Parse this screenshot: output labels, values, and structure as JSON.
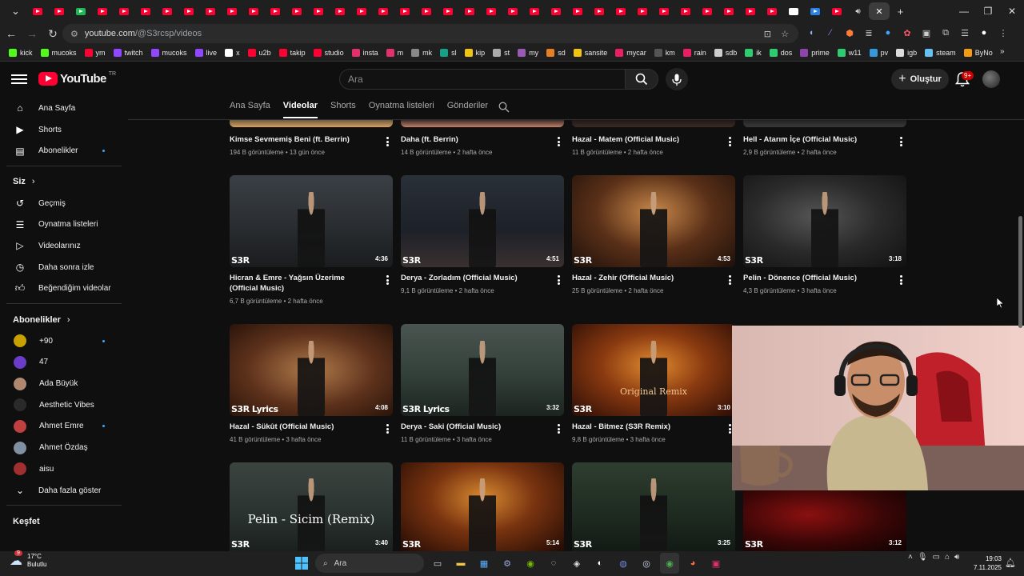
{
  "browser": {
    "url_host": "youtube.com",
    "url_path": "/@S3rcsp/videos",
    "bookmarks": [
      {
        "label": "kick",
        "color": "#53fc18"
      },
      {
        "label": "mucoks",
        "color": "#53fc18"
      },
      {
        "label": "ym",
        "color": "#ff0033"
      },
      {
        "label": "twitch",
        "color": "#9146ff"
      },
      {
        "label": "mucoks",
        "color": "#9146ff"
      },
      {
        "label": "live",
        "color": "#9146ff"
      },
      {
        "label": "x",
        "color": "#ffffff"
      },
      {
        "label": "u2b",
        "color": "#ff0033"
      },
      {
        "label": "takip",
        "color": "#ff0033"
      },
      {
        "label": "studio",
        "color": "#ff0033"
      },
      {
        "label": "insta",
        "color": "#e1306c"
      },
      {
        "label": "m",
        "color": "#e1306c"
      },
      {
        "label": "mk",
        "color": "#888888"
      },
      {
        "label": "sl",
        "color": "#16a085"
      },
      {
        "label": "kip",
        "color": "#f1c40f"
      },
      {
        "label": "st",
        "color": "#aaaaaa"
      },
      {
        "label": "my",
        "color": "#9b59b6"
      },
      {
        "label": "sd",
        "color": "#e67e22"
      },
      {
        "label": "sansite",
        "color": "#f1c40f"
      },
      {
        "label": "mycar",
        "color": "#e91e63"
      },
      {
        "label": "km",
        "color": "#555555"
      },
      {
        "label": "rain",
        "color": "#e91e63"
      },
      {
        "label": "sdb",
        "color": "#cccccc"
      },
      {
        "label": "ik",
        "color": "#2ecc71"
      },
      {
        "label": "dos",
        "color": "#2ecc71"
      },
      {
        "label": "prime",
        "color": "#8e44ad"
      },
      {
        "label": "w11",
        "color": "#2ecc71"
      },
      {
        "label": "pv",
        "color": "#3498db"
      },
      {
        "label": "igb",
        "color": "#dddddd"
      },
      {
        "label": "steam",
        "color": "#66c0f4"
      },
      {
        "label": "ByNo",
        "color": "#f39c12"
      }
    ]
  },
  "header": {
    "logo_text": "YouTube",
    "logo_region": "TR",
    "search_placeholder": "Ara",
    "create_label": "Oluştur",
    "notifications_badge": "9+"
  },
  "sidebar": {
    "main": [
      {
        "label": "Ana Sayfa",
        "icon": "home-icon",
        "dot": false
      },
      {
        "label": "Shorts",
        "icon": "shorts-icon",
        "dot": false
      },
      {
        "label": "Abonelikler",
        "icon": "subscriptions-icon",
        "dot": true
      }
    ],
    "you_heading": "Siz",
    "you": [
      {
        "label": "Geçmiş",
        "icon": "history-icon"
      },
      {
        "label": "Oynatma listeleri",
        "icon": "playlists-icon"
      },
      {
        "label": "Videolarınız",
        "icon": "your-videos-icon"
      },
      {
        "label": "Daha sonra izle",
        "icon": "watch-later-icon"
      },
      {
        "label": "Beğendiğim videolar",
        "icon": "liked-icon"
      }
    ],
    "subs_heading": "Abonelikler",
    "subs": [
      {
        "label": "+90",
        "dot": true,
        "color": "#c8a000"
      },
      {
        "label": "47",
        "dot": false,
        "color": "#6a3cc8"
      },
      {
        "label": "Ada Büyük",
        "dot": false,
        "color": "#b08870"
      },
      {
        "label": "Aesthetic Vibes",
        "dot": false,
        "color": "#2a2a2a"
      },
      {
        "label": "Ahmet Emre",
        "dot": true,
        "color": "#c04040"
      },
      {
        "label": "Ahmet Özdaş",
        "dot": false,
        "color": "#8090a0"
      },
      {
        "label": "aisu",
        "dot": false,
        "color": "#a03030"
      }
    ],
    "show_more": "Daha fazla göster",
    "explore_heading": "Keşfet"
  },
  "channel_tabs": [
    "Ana Sayfa",
    "Videolar",
    "Shorts",
    "Oynatma listeleri",
    "Gönderiler"
  ],
  "channel_tab_active": 1,
  "videos_row0": [
    {
      "title": "Kimse Sevmemiş Beni (ft. Berrin)",
      "meta": "194 B görüntüleme • 13 gün önce"
    },
    {
      "title": "Daha (ft. Berrin)",
      "meta": "14 B görüntüleme • 2 hafta önce"
    },
    {
      "title": "Hazal - Matem (Official Music)",
      "meta": "11 B görüntüleme • 2 hafta önce"
    },
    {
      "title": "Hell - Atarım İçe (Official Music)",
      "meta": "2,9 B görüntüleme • 2 hafta önce"
    }
  ],
  "videos": [
    {
      "title": "Hicran & Emre - Yağsın Üzerime (Official Music)",
      "meta": "6,7 B görüntüleme • 2 hafta önce",
      "duration": "4:36",
      "wm": "S3R",
      "bg": "linear-gradient(180deg,#3a3f45 0%,#2b2f33 50%,#1a1c1e 100%)"
    },
    {
      "title": "Derya - Zorladım (Official Music)",
      "meta": "9,1 B görüntüleme • 2 hafta önce",
      "duration": "4:51",
      "wm": "S3R",
      "bg": "linear-gradient(180deg,#2a3038 0%,#1d2128 60%,#3a3030 100%)"
    },
    {
      "title": "Hazal - Zehir (Official Music)",
      "meta": "25 B görüntüleme • 2 hafta önce",
      "duration": "4:53",
      "wm": "S3R",
      "bg": "radial-gradient(ellipse at 50% 40%,#c8884a 0%,#5a3018 50%,#1e100a 100%)"
    },
    {
      "title": "Pelin - Dönence (Official Music)",
      "meta": "4,3 B görüntüleme • 3 hafta önce",
      "duration": "3:18",
      "wm": "S3R",
      "bg": "radial-gradient(ellipse at 45% 45%,#555 0%,#2a2a2a 50%,#111 100%)"
    },
    {
      "title": "Hazal - Sükût (Official Music)",
      "meta": "41 B görüntüleme • 3 hafta önce",
      "duration": "4:08",
      "wm": "S3R Lyrics",
      "bg": "radial-gradient(ellipse at 50% 50%,#b07a4a 0%,#5e321c 55%,#2a140a 100%)"
    },
    {
      "title": "Derya - Saki (Official Music)",
      "meta": "11 B görüntüleme • 3 hafta önce",
      "duration": "3:32",
      "wm": "S3R Lyrics",
      "bg": "linear-gradient(180deg,#4a5450 0%,#33403a 55%,#1c2420 100%)"
    },
    {
      "title": "Hazal - Bitmez (S3R Remix)",
      "meta": "9,8 B görüntüleme • 3 hafta önce",
      "duration": "3:10",
      "wm": "S3R",
      "overlay": "Original Remix",
      "bg": "radial-gradient(ellipse at 50% 45%,#e08a30 0%,#8a3a10 45%,#2a0c06 100%)"
    },
    {
      "title": "",
      "meta": "",
      "duration": "",
      "wm": "",
      "bg": "none"
    },
    {
      "title": "",
      "meta": "",
      "duration": "3:40",
      "wm": "S3R",
      "overlay": "Pelin - Sicim (Remix)",
      "bg": "linear-gradient(180deg,#3c4440 0%,#2a3230 60%,#1a201e 100%)"
    },
    {
      "title": "",
      "meta": "",
      "duration": "5:14",
      "wm": "S3R",
      "bg": "radial-gradient(ellipse at 50% 40%,#d88a30 0%,#7a3410 45%,#220a04 100%)"
    },
    {
      "title": "",
      "meta": "",
      "duration": "3:25",
      "wm": "S3R",
      "bg": "linear-gradient(180deg,#2e3e30 0%,#1e2a20 60%,#121a14 100%)"
    },
    {
      "title": "",
      "meta": "",
      "duration": "3:12",
      "wm": "S3R",
      "bg": "radial-gradient(ellipse at 40% 40%,#8a1010 0%,#3a0606 55%,#0e0202 100%)"
    }
  ],
  "taskbar": {
    "weather_temp": "17°C",
    "weather_desc": "Bulutlu",
    "weather_badge": "9",
    "search_label": "Ara",
    "time": "19:03",
    "date": "7.11.2025"
  }
}
